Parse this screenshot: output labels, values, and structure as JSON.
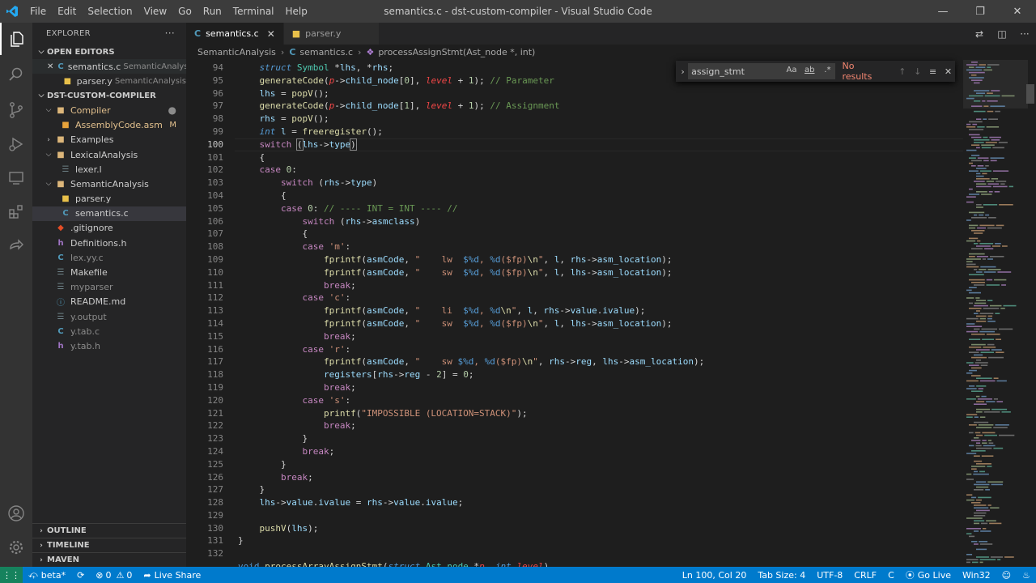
{
  "window": {
    "title": "semantics.c - dst-custom-compiler - Visual Studio Code",
    "menu": [
      "File",
      "Edit",
      "Selection",
      "View",
      "Go",
      "Run",
      "Terminal",
      "Help"
    ]
  },
  "explorer": {
    "title": "EXPLORER",
    "open_editors_label": "OPEN EDITORS",
    "open_editors": [
      {
        "name": "semantics.c",
        "folder": "SemanticAnalysis"
      },
      {
        "name": "parser.y",
        "folder": "SemanticAnalysis"
      }
    ],
    "project_label": "DST-CUSTOM-COMPILER",
    "tree": {
      "compiler": "Compiler",
      "assembly": "AssemblyCode.asm",
      "assembly_badge": "M",
      "examples": "Examples",
      "lexical": "LexicalAnalysis",
      "lexer": "lexer.l",
      "semantic": "SemanticAnalysis",
      "parser": "parser.y",
      "semantics": "semantics.c",
      "gitignore": ".gitignore",
      "definitions": "Definitions.h",
      "lexyy": "lex.yy.c",
      "makefile": "Makefile",
      "myparser": "myparser",
      "readme": "README.md",
      "youtput": "y.output",
      "ytabc": "y.tab.c",
      "ytabh": "y.tab.h"
    },
    "outline": "OUTLINE",
    "timeline": "TIMELINE",
    "maven": "MAVEN"
  },
  "tabs": [
    {
      "label": "semantics.c",
      "close": "✕"
    },
    {
      "label": "parser.y"
    }
  ],
  "breadcrumb": {
    "folder": "SemanticAnalysis",
    "file": "semantics.c",
    "symbol": "processAssignStmt(Ast_node *, int)"
  },
  "find": {
    "value": "assign_stmt",
    "opt_case": "Aa",
    "opt_word": "ab",
    "opt_regex": ".*",
    "result": "No results"
  },
  "editor": {
    "line_numbers": [
      "94",
      "95",
      "96",
      "97",
      "98",
      "99",
      "100",
      "101",
      "102",
      "103",
      "104",
      "105",
      "106",
      "107",
      "108",
      "109",
      "110",
      "111",
      "112",
      "113",
      "114",
      "115",
      "116",
      "117",
      "118",
      "119",
      "120",
      "121",
      "122",
      "123",
      "124",
      "125",
      "126",
      "127",
      "128",
      "129",
      "130",
      "131",
      "132"
    ],
    "current_line": "100"
  },
  "status": {
    "branch": "beta*",
    "errors": "0",
    "warnings": "0",
    "live_share": "Live Share",
    "position": "Ln 100, Col 20",
    "tab_size": "Tab Size: 4",
    "encoding": "UTF-8",
    "eol": "CRLF",
    "language": "C",
    "go_live": "Go Live",
    "platform": "Win32"
  },
  "colors": {
    "accent": "#007acc",
    "keyword": "#c586c0",
    "string": "#ce9178",
    "comment": "#6a9955"
  }
}
